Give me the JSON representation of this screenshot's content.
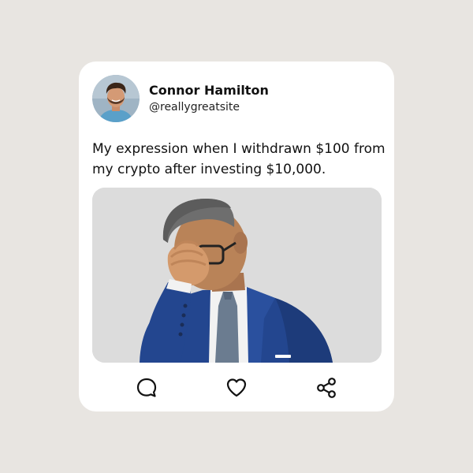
{
  "post": {
    "author": {
      "display_name": "Connor Hamilton",
      "handle": "@reallygreatsite",
      "avatar_icon": "man-portrait-avatar"
    },
    "text": "My expression when I withdrawn $100 from my crypto after investing $10,000.",
    "image_subject": "facepalm-businessman-illustration",
    "actions": [
      {
        "name": "comment",
        "icon": "comment-icon"
      },
      {
        "name": "like",
        "icon": "heart-icon"
      },
      {
        "name": "share",
        "icon": "share-icon"
      }
    ]
  },
  "colors": {
    "background": "#e8e5e1",
    "card": "#ffffff",
    "media_background": "#dcdcdc",
    "suit_blue": "#23468f",
    "icon": "#111111"
  }
}
